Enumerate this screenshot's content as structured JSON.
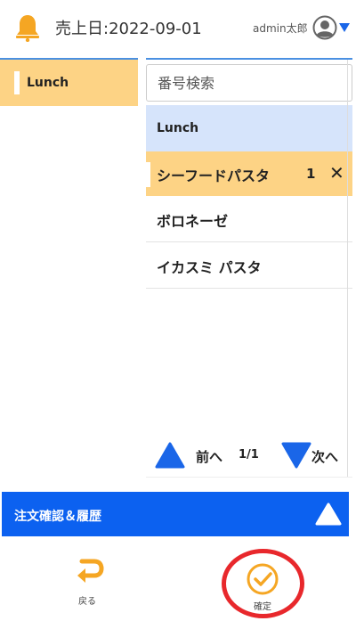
{
  "header": {
    "sales_date": "売上日:2022-09-01",
    "user_name": "admin太郎"
  },
  "categories": [
    {
      "label": "Lunch",
      "selected": true
    }
  ],
  "search": {
    "placeholder": "番号検索"
  },
  "product_group": {
    "title": "Lunch"
  },
  "products": [
    {
      "name": "シーフードパスタ",
      "quantity": "1",
      "selected": true
    },
    {
      "name": "ボロネーゼ"
    },
    {
      "name": "イカスミ パスタ"
    }
  ],
  "pagination": {
    "prev_label": "前へ",
    "page": "1/1",
    "next_label": "次へ"
  },
  "order_bar": {
    "label": "注文確認＆履歴"
  },
  "footer": {
    "back_label": "戻る",
    "confirm_label": "確定"
  },
  "icons": {
    "bell": "bell-icon",
    "avatar": "user-avatar-icon",
    "caret": "chevron-down-icon",
    "remove": "close-icon",
    "prev": "triangle-up-icon",
    "next": "triangle-down-icon",
    "expand": "triangle-up-icon",
    "back": "return-arrow-icon",
    "confirm": "check-circle-icon"
  },
  "colors": {
    "accent_orange": "#f5a623",
    "selected_bg": "#fdd385",
    "group_bg": "#d6e4fb",
    "primary_blue": "#0c61f0",
    "highlight_red": "#e8282c"
  }
}
